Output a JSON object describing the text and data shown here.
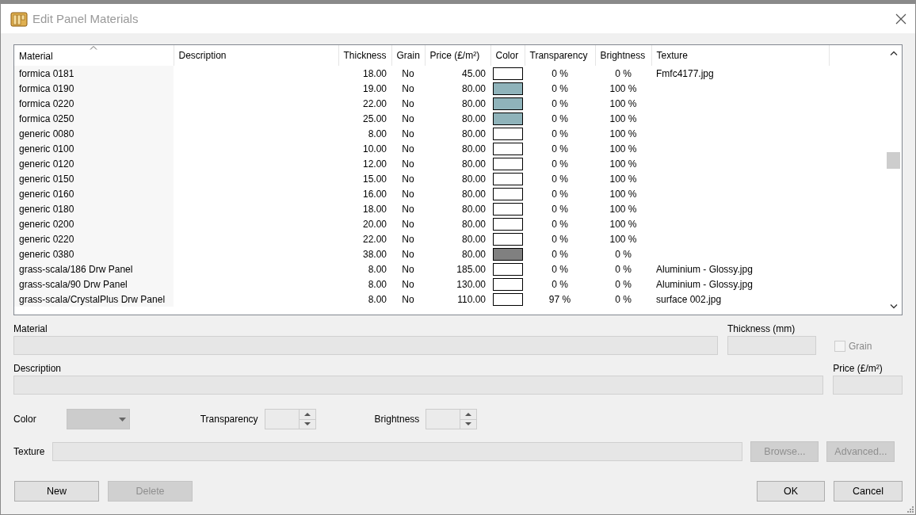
{
  "window": {
    "title": "Edit Panel Materials"
  },
  "table": {
    "columns": [
      {
        "label": "Material",
        "sorted": true
      },
      {
        "label": "Description",
        "sorted": false
      },
      {
        "label": "Thickness",
        "sorted": false
      },
      {
        "label": "Grain",
        "sorted": false
      },
      {
        "label": "Price (£/m²)",
        "sorted": false
      },
      {
        "label": "Color",
        "sorted": false
      },
      {
        "label": "Transparency",
        "sorted": false
      },
      {
        "label": "Brightness",
        "sorted": false
      },
      {
        "label": "Texture",
        "sorted": false
      }
    ],
    "rows": [
      {
        "material": "formica 0181",
        "thickness": "18.00",
        "grain": "No",
        "price": "45.00",
        "color": "#ffffff",
        "transparency": "0 %",
        "brightness": "0 %",
        "texture": "Fmfc4177.jpg"
      },
      {
        "material": "formica 0190",
        "thickness": "19.00",
        "grain": "No",
        "price": "80.00",
        "color": "#8fb3ba",
        "transparency": "0 %",
        "brightness": "100 %"
      },
      {
        "material": "formica 0220",
        "thickness": "22.00",
        "grain": "No",
        "price": "80.00",
        "color": "#8fb3ba",
        "transparency": "0 %",
        "brightness": "100 %"
      },
      {
        "material": "formica 0250",
        "thickness": "25.00",
        "grain": "No",
        "price": "80.00",
        "color": "#8fb3ba",
        "transparency": "0 %",
        "brightness": "100 %"
      },
      {
        "material": "generic 0080",
        "thickness": "8.00",
        "grain": "No",
        "price": "80.00",
        "color": "#ffffff",
        "transparency": "0 %",
        "brightness": "100 %"
      },
      {
        "material": "generic 0100",
        "thickness": "10.00",
        "grain": "No",
        "price": "80.00",
        "color": "#ffffff",
        "transparency": "0 %",
        "brightness": "100 %"
      },
      {
        "material": "generic 0120",
        "thickness": "12.00",
        "grain": "No",
        "price": "80.00",
        "color": "#ffffff",
        "transparency": "0 %",
        "brightness": "100 %"
      },
      {
        "material": "generic 0150",
        "thickness": "15.00",
        "grain": "No",
        "price": "80.00",
        "color": "#ffffff",
        "transparency": "0 %",
        "brightness": "100 %"
      },
      {
        "material": "generic 0160",
        "thickness": "16.00",
        "grain": "No",
        "price": "80.00",
        "color": "#ffffff",
        "transparency": "0 %",
        "brightness": "100 %"
      },
      {
        "material": "generic 0180",
        "thickness": "18.00",
        "grain": "No",
        "price": "80.00",
        "color": "#ffffff",
        "transparency": "0 %",
        "brightness": "100 %"
      },
      {
        "material": "generic 0200",
        "thickness": "20.00",
        "grain": "No",
        "price": "80.00",
        "color": "#ffffff",
        "transparency": "0 %",
        "brightness": "100 %"
      },
      {
        "material": "generic 0220",
        "thickness": "22.00",
        "grain": "No",
        "price": "80.00",
        "color": "#ffffff",
        "transparency": "0 %",
        "brightness": "100 %"
      },
      {
        "material": "generic 0380",
        "thickness": "38.00",
        "grain": "No",
        "price": "80.00",
        "color": "#808080",
        "transparency": "0 %",
        "brightness": "0 %"
      },
      {
        "material": "grass-scala/186 Drw Panel",
        "thickness": "8.00",
        "grain": "No",
        "price": "185.00",
        "color": "#ffffff",
        "transparency": "0 %",
        "brightness": "0 %",
        "texture": "Aluminium - Glossy.jpg"
      },
      {
        "material": "grass-scala/90 Drw Panel",
        "thickness": "8.00",
        "grain": "No",
        "price": "130.00",
        "color": "#ffffff",
        "transparency": "0 %",
        "brightness": "0 %",
        "texture": "Aluminium - Glossy.jpg"
      },
      {
        "material": "grass-scala/CrystalPlus Drw Panel",
        "thickness": "8.00",
        "grain": "No",
        "price": "110.00",
        "color": "#ffffff",
        "transparency": "97 %",
        "brightness": "0 %",
        "texture": "surface 002.jpg"
      }
    ]
  },
  "form": {
    "material_label": "Material",
    "thickness_label": "Thickness (mm)",
    "grain": {
      "label": "Grain",
      "checked": false,
      "disabled": true
    },
    "description_label": "Description",
    "price_label": "Price (£/m²)",
    "color_label": "Color",
    "transparency_label": "Transparency",
    "brightness_label": "Brightness",
    "texture_label": "Texture",
    "browse_button": {
      "label": "Browse...",
      "disabled": true
    },
    "advanced_button": {
      "label": "Advanced...",
      "disabled": true
    }
  },
  "buttons": [
    {
      "label": "New",
      "disabled": false
    },
    {
      "label": "Delete",
      "disabled": true
    },
    {
      "label": "OK",
      "disabled": false
    },
    {
      "label": "Cancel",
      "disabled": false
    }
  ]
}
